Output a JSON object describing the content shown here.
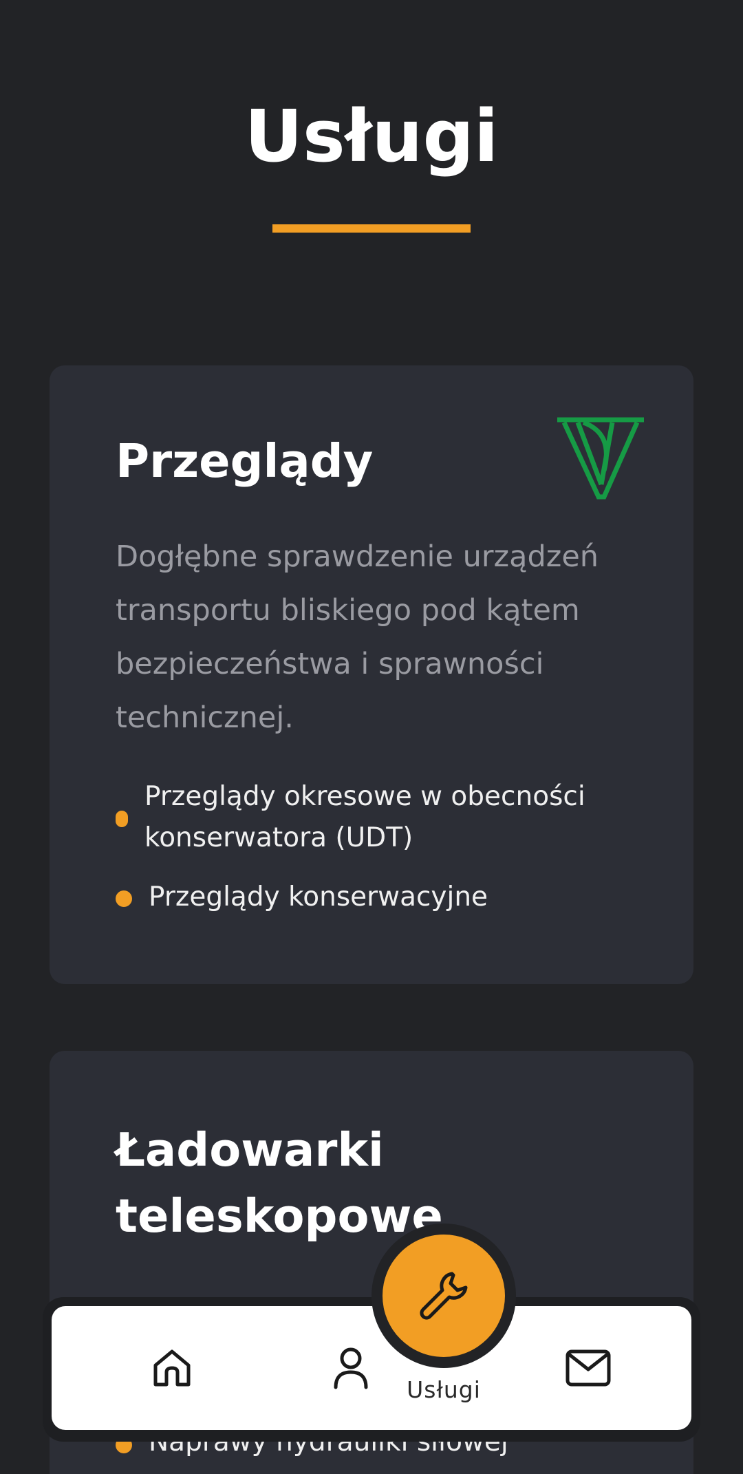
{
  "header": {
    "title": "Usługi"
  },
  "cards": [
    {
      "title": "Przeglądy",
      "description": "Dogłębne sprawdzenie urządzeń transportu bliskiego pod kątem bezpieczeństwa i sprawności technicznej.",
      "features": [
        "Przeglądy okresowe w obecności konserwatora (UDT)",
        "Przeglądy konserwacyjne"
      ],
      "logo": "udt-logo"
    },
    {
      "title": "Ładowarki teleskopowe",
      "features_visible": [
        "Naprawy hydrauliki siłowej"
      ]
    }
  ],
  "bottom_nav": {
    "items": [
      {
        "icon": "home-icon"
      },
      {
        "icon": "user-icon"
      },
      {
        "icon": "wrench-icon",
        "label": "Usługi",
        "active": true
      },
      {
        "icon": "mail-icon"
      }
    ]
  },
  "colors": {
    "background": "#222326",
    "card": "#2c2e36",
    "accent": "#f29e24",
    "nav": "#ffffff",
    "logo": "#169b45"
  }
}
